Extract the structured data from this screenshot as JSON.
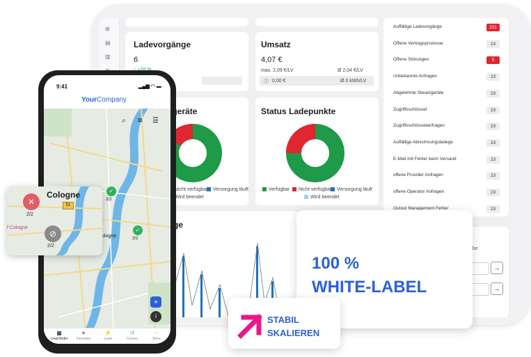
{
  "dashboard": {
    "ladevorgaenge": {
      "title": "Ladevorgänge",
      "value": "6",
      "trend": "↑ +20 %"
    },
    "umsatz": {
      "title": "Umsatz",
      "value": "4,07 €",
      "max_label": "max. 2,09 €/LV",
      "avg_label": "Ø 2,04 €/LV",
      "info_value": "0,00 €",
      "kwh_label": "Ø 0 kWh/LV"
    },
    "status_geraete": {
      "title": "ergeräte",
      "legend": [
        "Nicht verfügbar",
        "Versorgung läuft",
        "Wird beendet"
      ]
    },
    "status_ladepunkte": {
      "title": "Status Ladepunkte",
      "legend": [
        "Verfügbar",
        "Nicht verfügbar",
        "Versorgung läuft",
        "Wird beendet"
      ]
    },
    "chart_title": "ge",
    "form_label": "abe",
    "alerts": [
      {
        "label": "Auffällige Ladevorgänge",
        "count": "231",
        "red": true
      },
      {
        "label": "Offene Vertragsprozesse",
        "count": "23",
        "red": false
      },
      {
        "label": "Offene Störungen",
        "count": "5",
        "red": true
      },
      {
        "label": "Unbekannte Anfragen",
        "count": "23",
        "red": false
      },
      {
        "label": "Abgelehnte Steuergeräte",
        "count": "23",
        "red": false
      },
      {
        "label": "Zugriffsschlüssel",
        "count": "23",
        "red": false
      },
      {
        "label": "Zugriffsschlüsselanfragen",
        "count": "23",
        "red": false
      },
      {
        "label": "Auffällige Abrechnungsbelege",
        "count": "23",
        "red": false
      },
      {
        "label": "E-Mail mit Fehler beim Versand",
        "count": "23",
        "red": false
      },
      {
        "label": "offene Provider Anfragen",
        "count": "23",
        "red": false
      },
      {
        "label": "offene Operator Anfragen",
        "count": "23",
        "red": false
      },
      {
        "label": "Outout Management Fehler",
        "count": "23",
        "red": false
      }
    ],
    "arrow_glyph": "→"
  },
  "phone": {
    "time": "9:41",
    "brand_bold": "Your",
    "brand_light": "Company",
    "map_city": "Cologne",
    "marker_count": "2/2",
    "popup_city": "Cologne",
    "popup_road": "51",
    "popup_left_city": "f Cologne",
    "popup_counts": [
      "2/2",
      "2/2"
    ],
    "nav": [
      {
        "label": "Load finder",
        "icon": "map-icon",
        "active": true
      },
      {
        "label": "Favorites",
        "icon": "star-icon",
        "active": false
      },
      {
        "label": "Load",
        "icon": "lightning-icon",
        "active": false
      },
      {
        "label": "Course",
        "icon": "history-icon",
        "active": false
      },
      {
        "label": "More",
        "icon": "more-icon",
        "active": false
      }
    ]
  },
  "callouts": {
    "whitelabel_line1": "100 %",
    "whitelabel_line2": "WHITE-LABEL",
    "stabil_line1": "STABIL",
    "stabil_line2": "SKALIEREN"
  },
  "colors": {
    "green": "#1e9a48",
    "red": "#e0262f",
    "blue": "#1f73b7",
    "light_blue": "#9fd0f0",
    "accent_blue": "#2b60d8",
    "magenta": "#e8188b"
  }
}
